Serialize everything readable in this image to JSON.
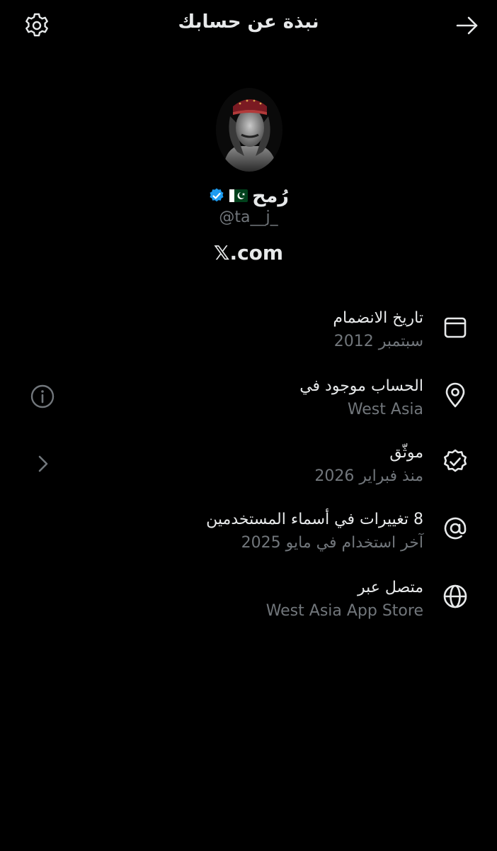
{
  "header": {
    "title": "نبذة عن حسابك",
    "settings_icon": "gear-icon",
    "back_icon": "arrow-right-icon"
  },
  "profile": {
    "display_name": "رُمح",
    "flag_icon": "pakistan-flag-icon",
    "verified_icon": "verified-badge-icon",
    "verified_color": "#1d9bf0",
    "handle": "@ta__j_",
    "site": "𝕏.com"
  },
  "details": [
    {
      "icon": "calendar-icon",
      "title": "تاريخ الانضمام",
      "value": "سبتمبر 2012"
    },
    {
      "icon": "location-pin-icon",
      "title": "الحساب موجود في",
      "value": "West Asia"
    },
    {
      "icon": "verified-check-icon",
      "title": "موثّق",
      "value": "منذ فبراير 2026"
    },
    {
      "icon": "at-sign-icon",
      "title": "8 تغييرات في أسماء المستخدمين",
      "value": "آخر استخدام في مايو 2025"
    },
    {
      "icon": "globe-icon",
      "title": "متصل عبر",
      "value": "West Asia App Store"
    }
  ],
  "side_controls": {
    "info_icon": "info-circle-icon",
    "chevron_icon": "chevron-right-icon"
  },
  "colors": {
    "background": "#000000",
    "primary_text": "#e7e9ea",
    "secondary_text": "#71767b"
  }
}
